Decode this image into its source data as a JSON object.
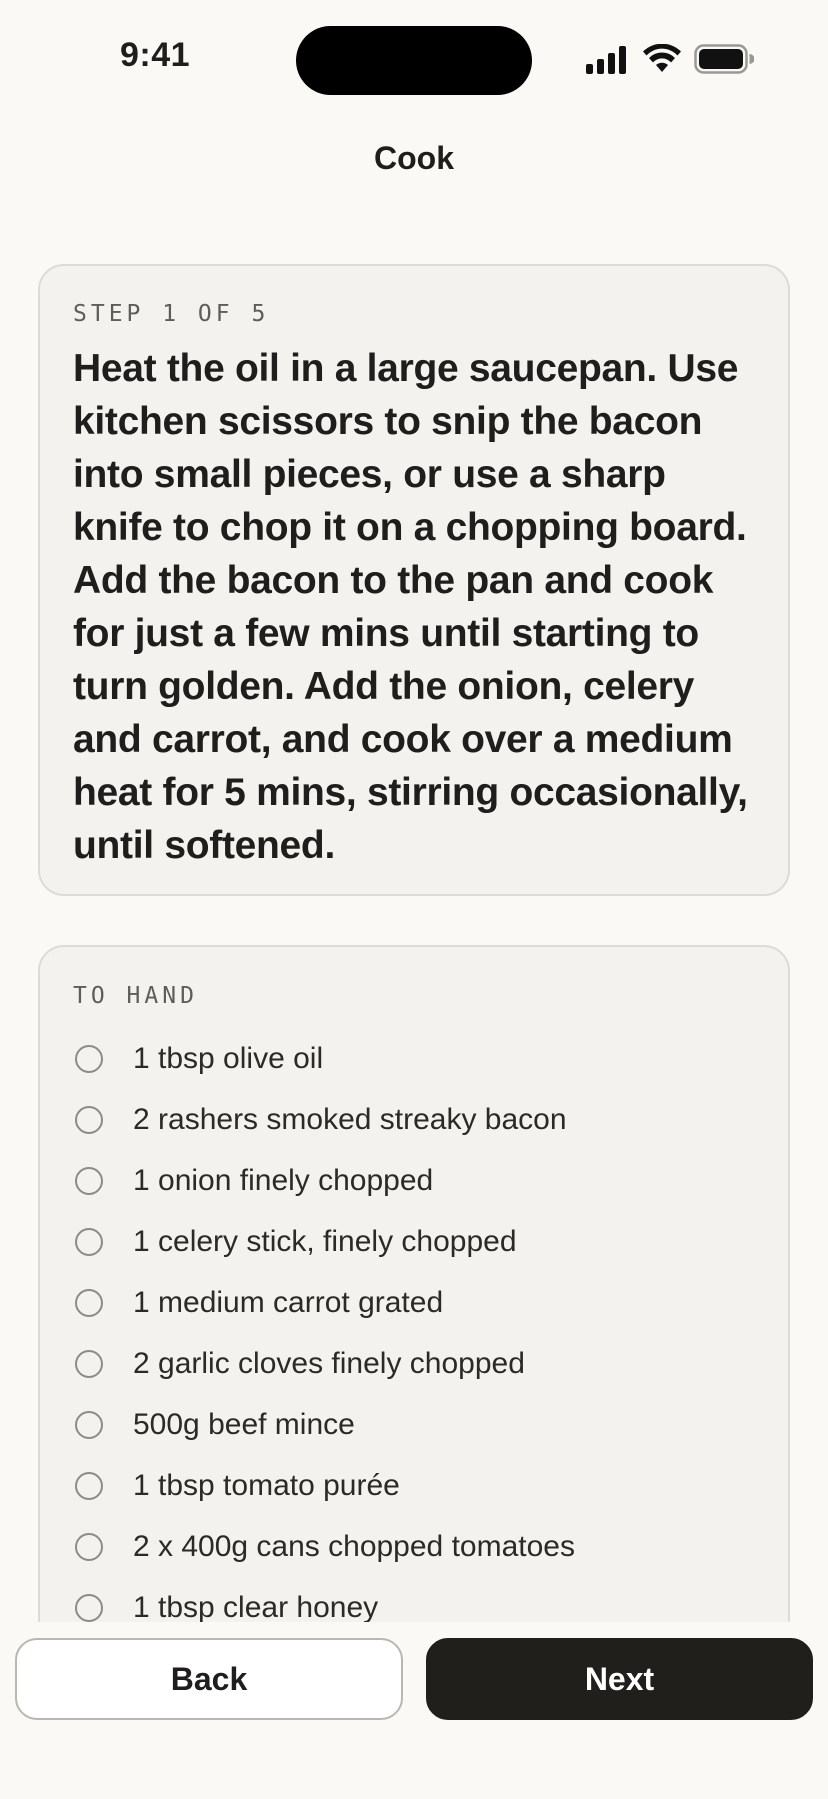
{
  "status_bar": {
    "time": "9:41",
    "icons": [
      "cellular-signal-icon",
      "wifi-icon",
      "battery-icon"
    ]
  },
  "nav": {
    "title": "Cook"
  },
  "step": {
    "label": "STEP 1 OF 5",
    "current": 1,
    "total": 5,
    "instruction": "Heat the oil in a large saucepan. Use kitchen scissors to snip the bacon into small pieces, or use a sharp knife to chop it on a chopping board. Add the bacon to the pan and cook for just a few mins until starting to turn golden. Add the onion, celery and carrot, and cook over a medium heat for 5 mins, stirring occasionally, until softened."
  },
  "to_hand": {
    "label": "TO HAND",
    "items": [
      {
        "text": "1 tbsp olive oil",
        "checked": false
      },
      {
        "text": "2 rashers smoked streaky bacon",
        "checked": false
      },
      {
        "text": "1 onion finely chopped",
        "checked": false
      },
      {
        "text": "1 celery stick, finely chopped",
        "checked": false
      },
      {
        "text": "1 medium carrot grated",
        "checked": false
      },
      {
        "text": "2 garlic cloves finely chopped",
        "checked": false
      },
      {
        "text": "500g beef mince",
        "checked": false
      },
      {
        "text": "1 tbsp tomato purée",
        "checked": false
      },
      {
        "text": "2 x 400g cans chopped tomatoes",
        "checked": false
      },
      {
        "text": "1 tbsp clear honey",
        "checked": false
      }
    ]
  },
  "actions": {
    "back_label": "Back",
    "next_label": "Next"
  },
  "colors": {
    "background": "#faf9f6",
    "card": "#f3f2ee",
    "primary": "#211f1c",
    "muted_text": "#5f5d58"
  }
}
